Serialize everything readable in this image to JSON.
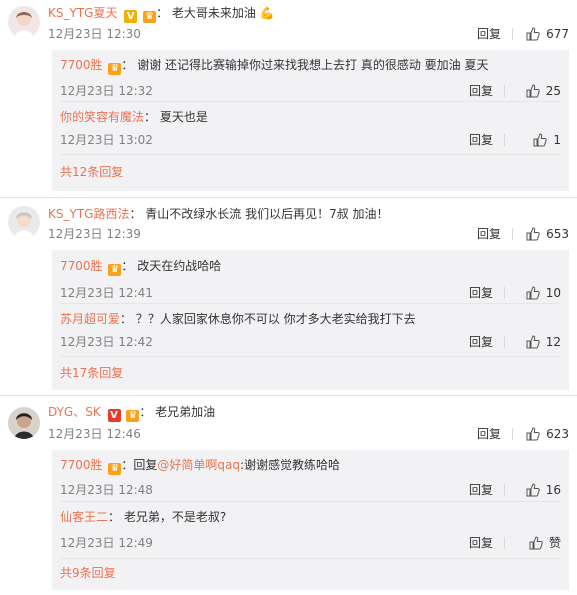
{
  "threads": [
    {
      "user": "KS_YTG夏天",
      "text": "老大哥未来加油",
      "time": "12月23日 12:30",
      "reply_label": "回复",
      "likes": "677",
      "subs": [
        {
          "user": "7700胜",
          "text": "谢谢  还记得比赛输掉你过来找我想上去打 真的很感动 要加油 夏天",
          "time": "12月23日 12:32",
          "reply_label": "回复",
          "likes": "25"
        },
        {
          "user": "你的笑容有魔法",
          "text": "夏天也是",
          "time": "12月23日 13:02",
          "reply_label": "回复",
          "likes": "1"
        }
      ],
      "more": "共12条回复"
    },
    {
      "user": "KS_YTG路西法",
      "text": "青山不改绿水长流 我们以后再见！7叔 加油！",
      "time": "12月23日 12:39",
      "reply_label": "回复",
      "likes": "653",
      "subs": [
        {
          "user": "7700胜",
          "text": "改天在约战哈哈",
          "time": "12月23日 12:41",
          "reply_label": "回复",
          "likes": "10"
        },
        {
          "user": "苏月超可爱",
          "text": "？？人家回家休息你不可以 你才多大老实给我打下去",
          "time": "12月23日 12:42",
          "reply_label": "回复",
          "likes": "12"
        }
      ],
      "more": "共17条回复"
    },
    {
      "user": "DYG、SK",
      "text": "老兄弟加油",
      "time": "12月23日 12:46",
      "reply_label": "回复",
      "likes": "623",
      "subs": [
        {
          "user": "7700胜",
          "reply_prefix": "回复",
          "mention": "@好简单啊qaq",
          "text": ":谢谢感觉教练哈哈",
          "time": "12月23日 12:48",
          "reply_label": "回复",
          "likes": "16"
        },
        {
          "user": "仙客王二",
          "text": "老兄弟，不是老叔?",
          "time": "12月23日 12:49",
          "reply_label": "回复",
          "likes": "赞"
        }
      ],
      "more": "共9条回复"
    }
  ],
  "colors": {
    "username": "#eb7350",
    "subbox_bg": "#f2f2f5",
    "meta": "#808080"
  },
  "icons": {
    "like": "thumbs-up-icon",
    "member_badge": "crown-badge-icon",
    "verified": "verified-v-icon"
  }
}
